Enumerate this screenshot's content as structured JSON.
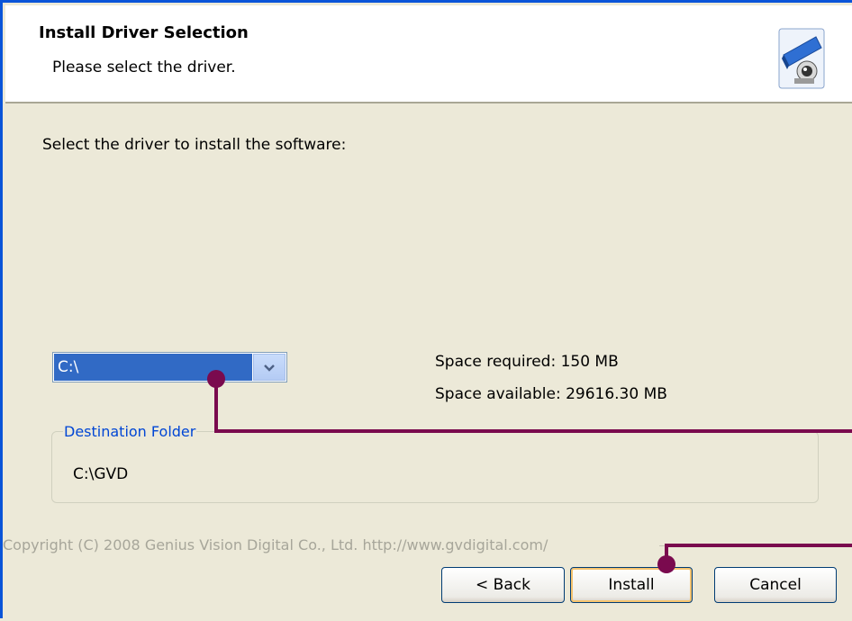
{
  "header": {
    "title": "Install Driver Selection",
    "subtitle": "Please select the driver."
  },
  "main": {
    "prompt": "Select the driver to install the software:",
    "drive_select": {
      "value": "C:\\"
    },
    "space_required": "Space required: 150 MB",
    "space_available": "Space available: 29616.30 MB",
    "destination": {
      "legend": "Destination Folder",
      "path": "C:\\GVD"
    }
  },
  "footer": {
    "copyright": "Copyright (C) 2008 Genius Vision Digital Co., Ltd. http://www.gvdigital.com/"
  },
  "buttons": {
    "back": "< Back",
    "install": "Install",
    "cancel": "Cancel"
  },
  "colors": {
    "accent": "#0a54d8",
    "selection": "#316ac5",
    "annotation_line": "#7a0a4e"
  }
}
